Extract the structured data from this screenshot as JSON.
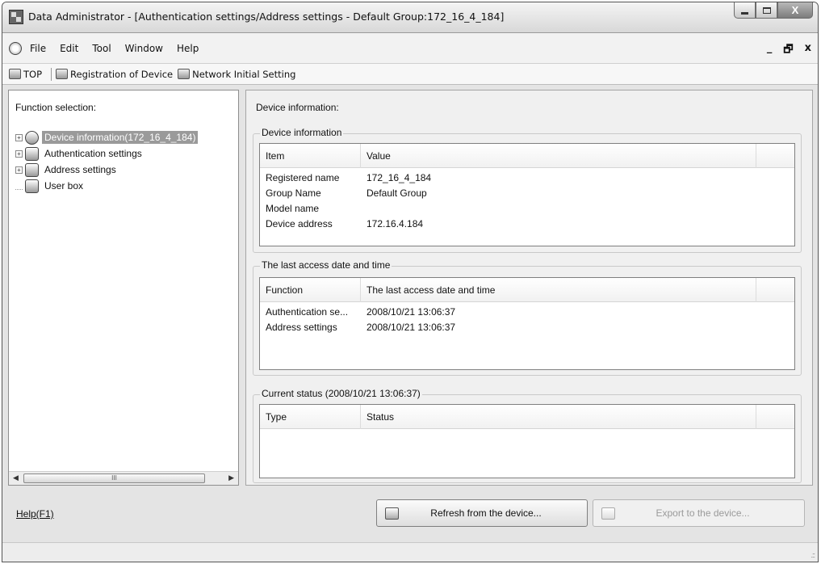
{
  "window": {
    "title": "Data Administrator - [Authentication settings/Address settings - Default Group:172_16_4_184]",
    "close_glyph": "X"
  },
  "menu": {
    "items": [
      "File",
      "Edit",
      "Tool",
      "Window",
      "Help"
    ],
    "mdi_minimize": "_",
    "mdi_restore": "Θ",
    "mdi_close": "x"
  },
  "toolbar": {
    "top_label": "TOP",
    "registration_label": "Registration of Device",
    "network_label": "Network Initial Setting"
  },
  "left_pane": {
    "title": "Function selection:",
    "tree": [
      {
        "label": "Device information(172_16_4_184)",
        "icon": "device-info-icon",
        "expandable": true,
        "selected": true
      },
      {
        "label": "Authentication settings",
        "icon": "authentication-icon",
        "expandable": true,
        "selected": false
      },
      {
        "label": "Address settings",
        "icon": "address-book-icon",
        "expandable": true,
        "selected": false
      },
      {
        "label": "User box",
        "icon": "user-box-icon",
        "expandable": false,
        "selected": false
      }
    ],
    "scroll_thumb_glyph": "III"
  },
  "right_pane": {
    "title": "Device information:",
    "device_info": {
      "legend": "Device information",
      "columns": [
        "Item",
        "Value"
      ],
      "rows": [
        [
          "Registered name",
          "172_16_4_184"
        ],
        [
          "Group Name",
          "Default Group"
        ],
        [
          "Model name",
          ""
        ],
        [
          "Device address",
          "172.16.4.184"
        ]
      ]
    },
    "last_access": {
      "legend": "The last access date and time",
      "columns": [
        "Function",
        "The last access date and time"
      ],
      "rows": [
        [
          "Authentication se...",
          "2008/10/21 13:06:37"
        ],
        [
          "Address settings",
          "2008/10/21 13:06:37"
        ]
      ]
    },
    "current_status": {
      "legend": "Current status (2008/10/21 13:06:37)",
      "columns": [
        "Type",
        "Status"
      ],
      "rows": []
    }
  },
  "footer": {
    "help_label": "Help(F1)",
    "refresh_label": "Refresh from the device...",
    "export_label": "Export to the device..."
  }
}
